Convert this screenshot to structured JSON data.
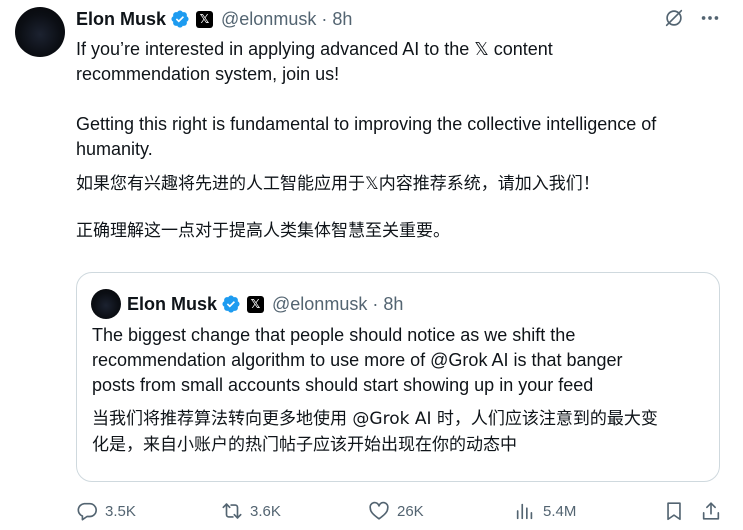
{
  "post": {
    "author_name": "Elon Musk",
    "author_handle": "@elonmusk",
    "separator": "·",
    "time": "8h",
    "x_badge": "𝕏",
    "text": {
      "p1_line1": "If you’re interested in applying advanced AI to the 𝕏 content",
      "p1_line2": "recommendation system, join us!",
      "p2_line1": "Getting this right is fundamental to improving the collective intelligence of",
      "p2_line2": "humanity.",
      "zh1": "如果您有兴趣将先进的人工智能应用于𝕏内容推荐系统，请加入我们！",
      "zh2": "正确理解这一点对于提高人类集体智慧至关重要。"
    }
  },
  "quote": {
    "author_name": "Elon Musk",
    "author_handle": "@elonmusk",
    "separator": "·",
    "time": "8h",
    "x_badge": "𝕏",
    "text": {
      "line1": "The biggest change that people should notice as we shift the",
      "line2": "recommendation algorithm to use more of @Grok AI is that banger",
      "line3": "posts from small accounts should start showing up in your feed",
      "zh_line1": "当我们将推荐算法转向更多地使用 @Grok AI 时，人们应该注意到的最大变",
      "zh_line2": "化是，来自小账户的热门帖子应该开始出现在你的动态中"
    }
  },
  "actions": {
    "replies": "3.5K",
    "reposts": "3.6K",
    "likes": "26K",
    "views": "5.4M"
  },
  "colors": {
    "verified": "#1d9bf0",
    "muted": "#536471",
    "text": "#0f1419",
    "border": "#cfd9de"
  },
  "icons": {
    "verified": "verified-badge-icon",
    "x_badge": "x-logo-icon",
    "grok": "grok-icon",
    "more": "more-icon",
    "reply": "reply-icon",
    "retweet": "retweet-icon",
    "like": "heart-icon",
    "views": "views-chart-icon",
    "bookmark": "bookmark-icon",
    "share": "share-icon"
  }
}
